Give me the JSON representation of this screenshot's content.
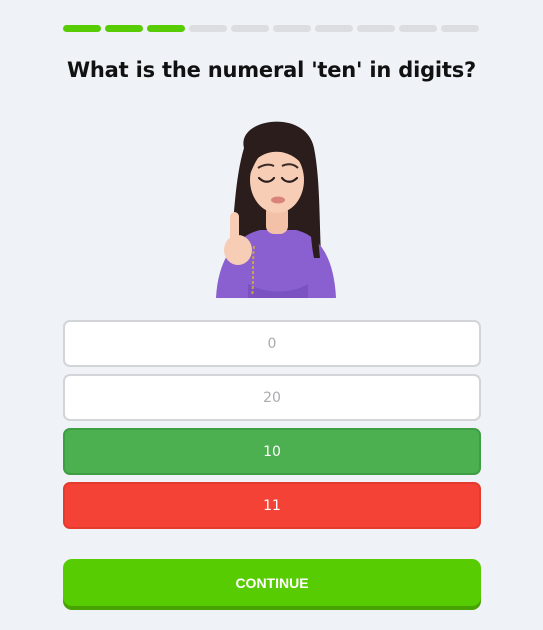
{
  "progress": {
    "completed": 3,
    "total": 10,
    "color_done": "#58cc02",
    "color_todo": "#dcdde0"
  },
  "question": "What is the numeral 'ten' in digits?",
  "avatar": {
    "icon": "avatar-girl-shush-icon"
  },
  "options": [
    {
      "label": "0",
      "state": "neutral"
    },
    {
      "label": "20",
      "state": "neutral"
    },
    {
      "label": "10",
      "state": "correct"
    },
    {
      "label": "11",
      "state": "wrong"
    }
  ],
  "continue_label": "CONTINUE",
  "colors": {
    "correct": "#4caf50",
    "wrong": "#f44336",
    "accent": "#58cc02",
    "background": "#eff2f7"
  }
}
